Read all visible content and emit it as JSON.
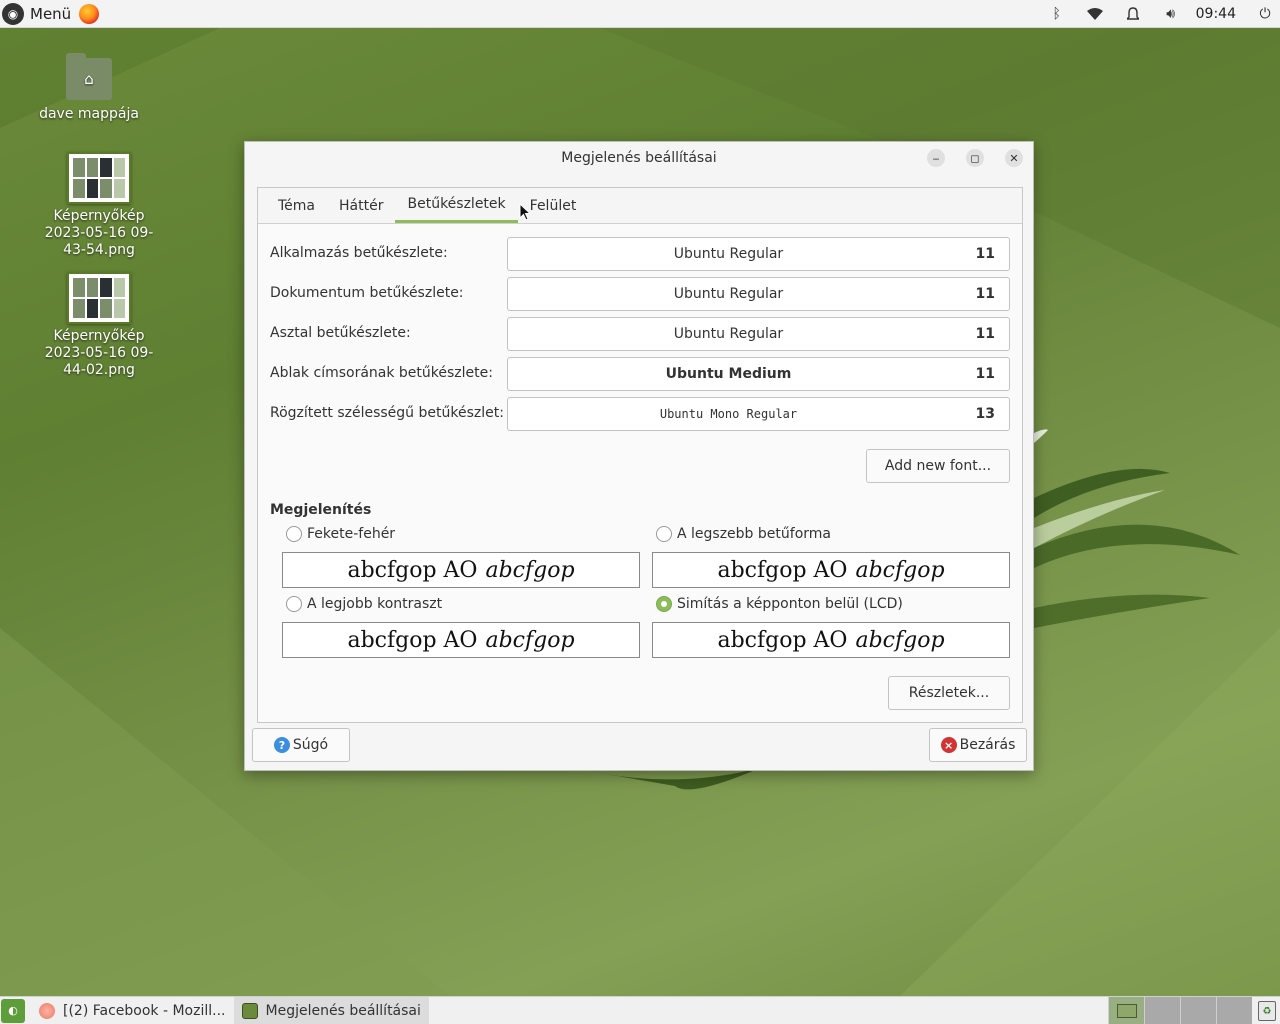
{
  "top_panel": {
    "menu_label": "Menü",
    "clock": "09:44",
    "icons": [
      "menu-logo-icon",
      "firefox-icon",
      "bluetooth-icon",
      "wifi-icon",
      "bell-icon",
      "volume-icon",
      "power-icon"
    ]
  },
  "desktop": {
    "icons": [
      {
        "label": "dave mappája",
        "type": "home-folder-icon"
      },
      {
        "label": "Képernyőkép 2023-05-16 09-43-54.png",
        "type": "image-thumbnail-icon"
      },
      {
        "label": "Képernyőkép 2023-05-16 09-44-02.png",
        "type": "image-thumbnail-icon"
      }
    ]
  },
  "dialog": {
    "title": "Megjelenés beállításai",
    "tabs": [
      {
        "label": "Téma"
      },
      {
        "label": "Háttér"
      },
      {
        "label": "Betűkészletek",
        "active": true
      },
      {
        "label": "Felület"
      }
    ],
    "fonts": [
      {
        "label": "Alkalmazás betűkészlete:",
        "font": "Ubuntu Regular",
        "size": "11"
      },
      {
        "label": "Dokumentum betűkészlete:",
        "font": "Ubuntu Regular",
        "size": "11"
      },
      {
        "label": "Asztal betűkészlete:",
        "font": "Ubuntu Regular",
        "size": "11"
      },
      {
        "label": "Ablak címsorának betűkészlete:",
        "font": "Ubuntu Medium",
        "size": "11"
      },
      {
        "label": "Rögzített szélességű betűkészlet:",
        "font": "Ubuntu Mono Regular",
        "size": "13"
      }
    ],
    "add_font_label": "Add new font...",
    "rendering": {
      "title": "Megjelenítés",
      "sample_regular": "abcfgop AO",
      "sample_italic": "abcfgop",
      "options": [
        {
          "label": "Fekete-fehér",
          "selected": false
        },
        {
          "label": "A legszebb betűforma",
          "selected": false
        },
        {
          "label": "A legjobb kontraszt",
          "selected": false
        },
        {
          "label": "Simítás a képponton belül (LCD)",
          "selected": true
        }
      ]
    },
    "details_label": "Részletek...",
    "help_label": "Súgó",
    "close_label": "Bezárás"
  },
  "taskbar": {
    "items": [
      {
        "label": "[(2) Facebook - Mozill...",
        "icon": "firefox-icon",
        "active": false
      },
      {
        "label": "Megjelenés beállításai",
        "icon": "appearance-icon",
        "active": true
      }
    ],
    "workspace_count": 4,
    "current_workspace": 1
  },
  "colors": {
    "accent": "#8fbc5a",
    "desktop_green": "#6b8a3a",
    "help_blue": "#3b8ee0",
    "close_red": "#d23333"
  }
}
